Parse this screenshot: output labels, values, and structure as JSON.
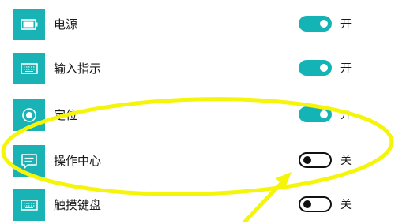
{
  "settings": [
    {
      "label": "电源",
      "icon": "battery-icon",
      "on": true,
      "state": "开"
    },
    {
      "label": "输入指示",
      "icon": "keyboard-icon",
      "on": true,
      "state": "开"
    },
    {
      "label": "定位",
      "icon": "location-icon",
      "on": true,
      "state": "开"
    },
    {
      "label": "操作中心",
      "icon": "action-center-icon",
      "on": false,
      "state": "关"
    },
    {
      "label": "触摸键盘",
      "icon": "touch-keyboard-icon",
      "on": false,
      "state": "关"
    }
  ],
  "colors": {
    "accent": "#1ab3b5",
    "highlight": "#f5f50a"
  }
}
